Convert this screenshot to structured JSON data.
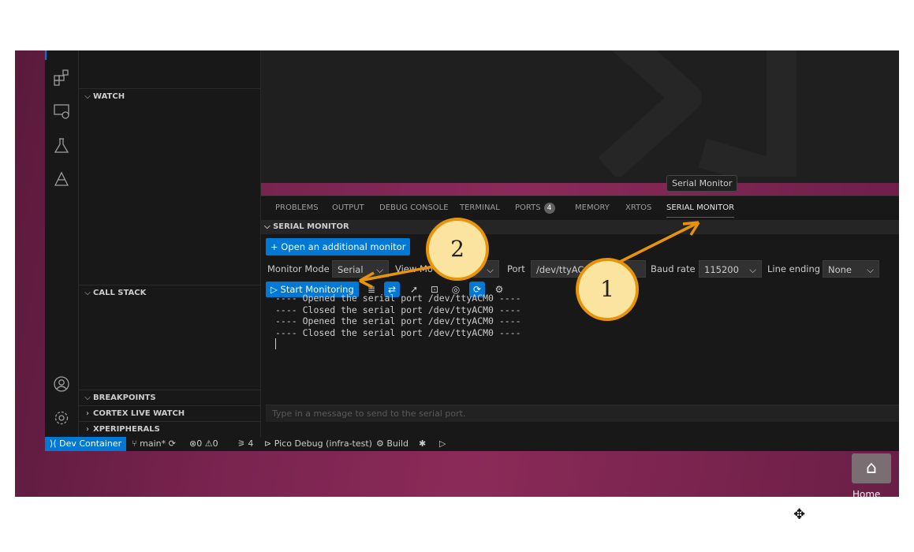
{
  "activity_bar": {
    "icons": [
      "extensions-icon",
      "remote-explorer-icon",
      "testing-icon",
      "pico-icon",
      "account-icon",
      "settings-gear-icon"
    ]
  },
  "sidebar": {
    "watch": "WATCH",
    "call_stack": "CALL STACK",
    "breakpoints": "BREAKPOINTS",
    "cortex_live_watch": "CORTEX LIVE WATCH",
    "xperipherals": "XPERIPHERALS"
  },
  "tooltip": "Serial Monitor",
  "panel": {
    "tabs": [
      {
        "label": "PROBLEMS"
      },
      {
        "label": "OUTPUT"
      },
      {
        "label": "DEBUG CONSOLE"
      },
      {
        "label": "TERMINAL"
      },
      {
        "label": "PORTS",
        "badge": "4"
      },
      {
        "label": "MEMORY"
      },
      {
        "label": "XRTOS"
      },
      {
        "label": "SERIAL MONITOR",
        "active": true
      }
    ],
    "ports_badge": "4"
  },
  "serial_monitor": {
    "header": "SERIAL MONITOR",
    "open_additional": "Open an additional monitor",
    "monitor_mode_label": "Monitor Mode",
    "monitor_mode_value": "Serial",
    "view_mode_label": "View Mo",
    "port_label": "Port",
    "port_value": "/dev/ttyAC",
    "baud_label": "Baud rate",
    "baud_value": "115200",
    "line_ending_label": "Line ending",
    "line_ending_value": "None",
    "start_monitoring": "Start Monitoring",
    "output_lines": [
      "---- Opened the serial port /dev/ttyACM0 ----",
      "---- Closed the serial port /dev/ttyACM0 ----",
      "---- Opened the serial port /dev/ttyACM0 ----",
      "---- Closed the serial port /dev/ttyACM0 ----"
    ],
    "input_placeholder": "Type in a message to send to the serial port."
  },
  "status_bar": {
    "remote": "Dev Container",
    "branch": "main*",
    "errors": "0",
    "warnings": "0",
    "ports": "4",
    "debug_target": "Pico Debug (infra-test)",
    "build": "Build"
  },
  "desktop": {
    "home_label": "Home"
  },
  "callouts": {
    "one": "1",
    "two": "2"
  },
  "colors": {
    "accent": "#0078d4",
    "callout_fill": "#fbe3a0",
    "callout_stroke": "#e8940a"
  }
}
